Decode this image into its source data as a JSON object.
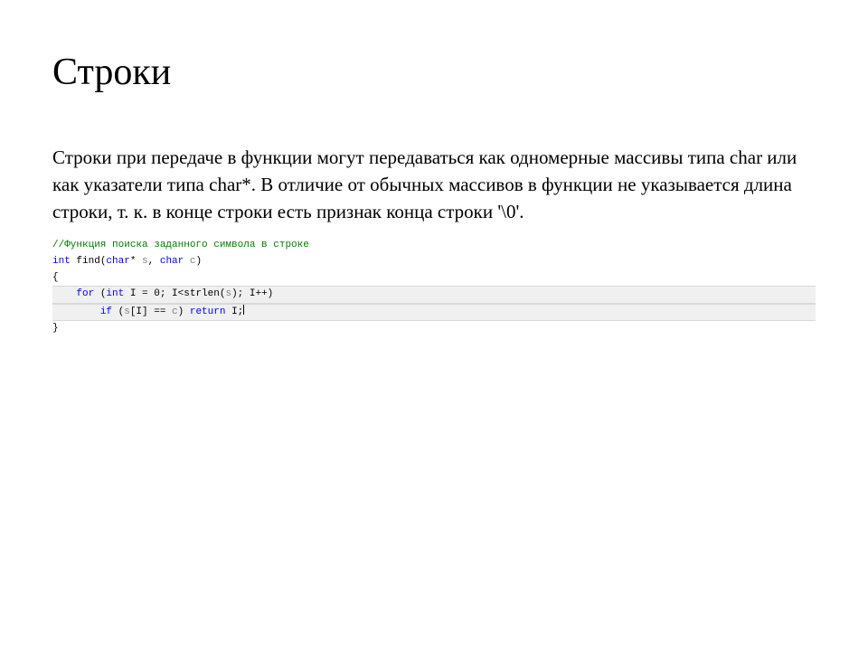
{
  "title": "Строки",
  "paragraph": "Строки при передаче в функции могут передаваться как одномерные массивы типа char или как указатели типа char*. В отличие от обычных массивов в функции не указывается длина строки, т. к. в конце строки есть признак конца строки '\\0'.",
  "code": {
    "comment": "//Функция поиска заданного символа в строке",
    "kw_int": "int",
    "fn_name": " find(",
    "kw_char1": "char",
    "star_s": "* ",
    "var_s": "s",
    "comma1": ", ",
    "kw_char2": "char",
    "space_c": " ",
    "var_c": "c",
    "close_paren": ")",
    "brace_open": "{",
    "indent1": "    ",
    "kw_for": "for",
    "for_open": " (",
    "kw_int2": "int",
    "for_body1": " I = 0; I<strlen(",
    "var_s2": "s",
    "for_body2": "); I++)",
    "indent2": "        ",
    "kw_if": "if",
    "if_open": " (",
    "var_s3": "s",
    "if_body1": "[I] == ",
    "var_c2": "c",
    "if_body2": ") ",
    "kw_return": "return",
    "ret_body": " I;",
    "brace_close": "}"
  }
}
